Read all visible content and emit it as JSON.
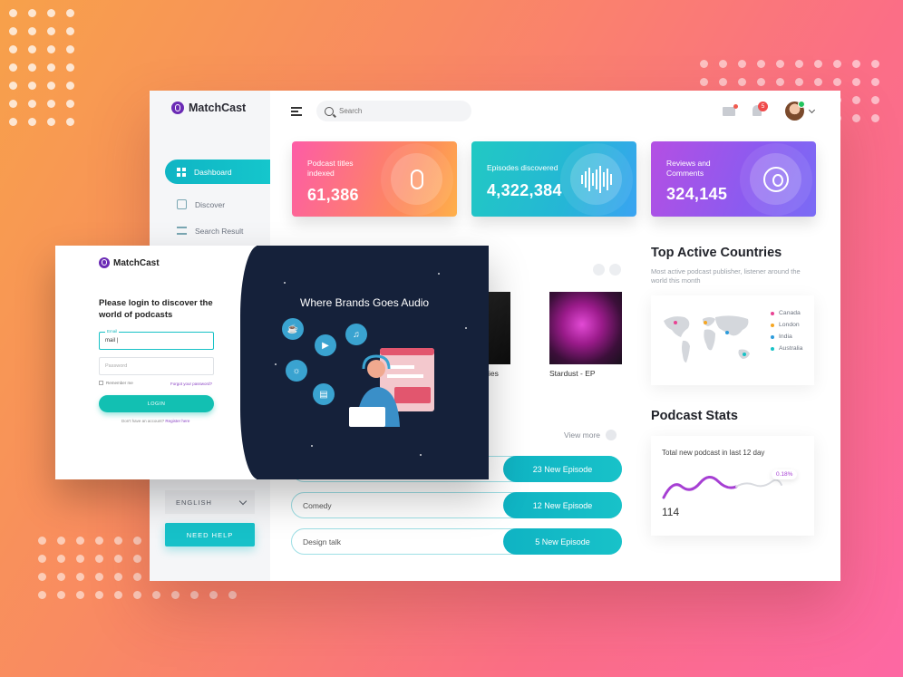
{
  "app": {
    "name": "MatchCast"
  },
  "sidebar": {
    "items": [
      {
        "label": "Dashboard",
        "icon": "dashboard-grid-icon",
        "active": true
      },
      {
        "label": "Discover",
        "icon": "cube-icon",
        "active": false
      },
      {
        "label": "Search Result",
        "icon": "stack-icon",
        "active": false
      }
    ],
    "language": "ENGLISH",
    "help_label": "NEED HELP"
  },
  "header": {
    "search_placeholder": "Search",
    "notification_count": "5"
  },
  "stats": [
    {
      "label": "Podcast titles indexed",
      "value": "61,386",
      "icon": "microphone-icon"
    },
    {
      "label": "Episodes discovered",
      "value": "4,322,384",
      "icon": "sound-wave-icon"
    },
    {
      "label": "Reviews and Comments",
      "value": "324,145",
      "icon": "podcast-icon"
    }
  ],
  "albums": [
    {
      "title": "ies"
    },
    {
      "title": "Stardust - EP"
    }
  ],
  "countries": {
    "title": "Top Active Countries",
    "subtitle": "Most active podcast publisher, listener around the world this month",
    "legend": [
      {
        "name": "Canada",
        "color": "#e84393"
      },
      {
        "name": "London",
        "color": "#f5a623"
      },
      {
        "name": "India",
        "color": "#2d9cdb"
      },
      {
        "name": "Australia",
        "color": "#17c2c6"
      }
    ]
  },
  "podcast_stats": {
    "title": "Podcast Stats",
    "caption": "Total new podcast in last 12 day",
    "value": "114",
    "percent": "0.18%"
  },
  "episodes": {
    "view_more": "View more",
    "rows": [
      {
        "genre": "",
        "count": "23 New Episode"
      },
      {
        "genre": "Comedy",
        "count": "12 New Episode"
      },
      {
        "genre": "Design talk",
        "count": "5 New Episode"
      }
    ]
  },
  "login": {
    "logo": "MatchCast",
    "heading": "Please login to discover the world of podcasts",
    "email_label": "Email",
    "email_value": "mail |",
    "password_placeholder": "Password",
    "remember": "Remember me",
    "forgot": "Forgot your password?",
    "button": "LOGIN",
    "no_account": "Don't have an account?",
    "register": "Register here",
    "brand_title": "Where Brands Goes Audio"
  }
}
